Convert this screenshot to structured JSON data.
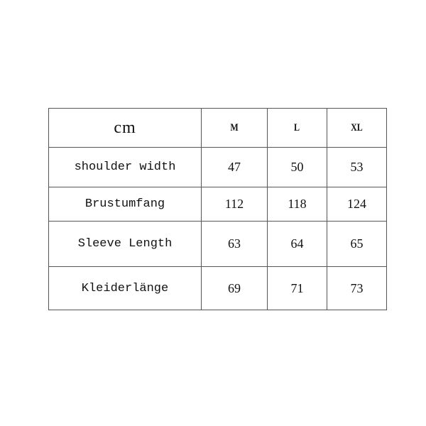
{
  "table": {
    "unit": "cm",
    "sizes": [
      "M",
      "L",
      "XL"
    ],
    "rows": [
      {
        "label": "shoulder width",
        "values": [
          "47",
          "50",
          "53"
        ]
      },
      {
        "label": "Brustumfang",
        "values": [
          "112",
          "118",
          "124"
        ]
      },
      {
        "label": "Sleeve Length",
        "values": [
          "63",
          "64",
          "65"
        ]
      },
      {
        "label": "Kleiderlänge",
        "values": [
          "69",
          "71",
          "73"
        ]
      }
    ]
  }
}
